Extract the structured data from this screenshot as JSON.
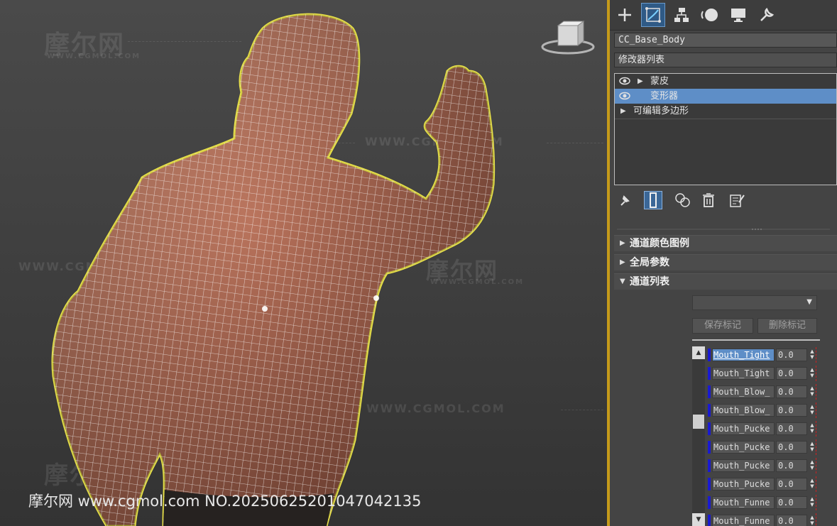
{
  "viewport": {
    "watermark_logo": "摩尔网",
    "watermark_url": "WWW.CGMOL.COM",
    "caption": "摩尔网 www.cgmol.com NO.20250625201047042135"
  },
  "panel": {
    "tabs": [
      {
        "icon": "create-plus-icon"
      },
      {
        "icon": "modify-icon"
      },
      {
        "icon": "hierarchy-icon"
      },
      {
        "icon": "motion-icon"
      },
      {
        "icon": "display-icon"
      },
      {
        "icon": "utilities-wrench-icon"
      }
    ],
    "object_name": "CC_Base_Body",
    "modifier_list_label": "修改器列表",
    "stack": [
      {
        "label": "蒙皮",
        "eye": true,
        "expand": true
      },
      {
        "label": "变形器",
        "eye": true,
        "expand": false,
        "selected": true
      },
      {
        "label": "可编辑多边形",
        "eye": false,
        "expand": true
      }
    ],
    "rollouts": [
      {
        "label": "通道颜色图例",
        "open": false
      },
      {
        "label": "全局参数",
        "open": false
      },
      {
        "label": "通道列表",
        "open": true
      }
    ],
    "buttons": {
      "save_marker": "保存标记",
      "delete_marker": "删除标记"
    },
    "channels": [
      {
        "name": "Mouth_Tight",
        "value": "0.0",
        "selected": true
      },
      {
        "name": "Mouth_Tight",
        "value": "0.0"
      },
      {
        "name": "Mouth_Blow_",
        "value": "0.0"
      },
      {
        "name": "Mouth_Blow_",
        "value": "0.0"
      },
      {
        "name": "Mouth_Pucke",
        "value": "0.0"
      },
      {
        "name": "Mouth_Pucke",
        "value": "0.0"
      },
      {
        "name": "Mouth_Pucke",
        "value": "0.0"
      },
      {
        "name": "Mouth_Pucke",
        "value": "0.0"
      },
      {
        "name": "Mouth_Funne",
        "value": "0.0"
      },
      {
        "name": "Mouth_Funne",
        "value": "0.0"
      }
    ],
    "colors": {
      "accent": "#5e8ec7",
      "selection_outline": "#e8e04a",
      "divider": "#c59a1a",
      "channel_bar": "#1a1ad0"
    }
  }
}
